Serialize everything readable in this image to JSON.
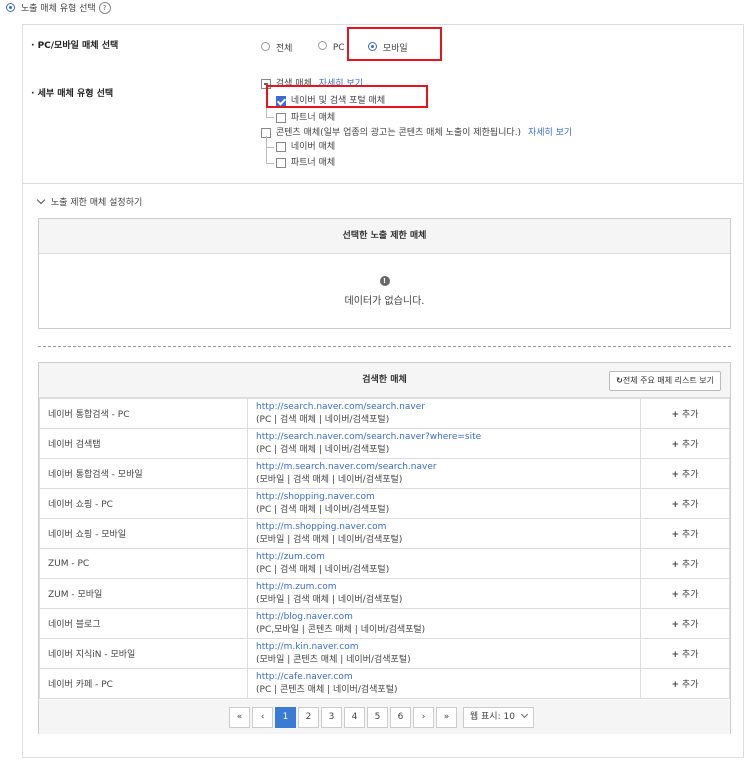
{
  "header": {
    "title": "노출 매체 유형 선택",
    "help": "?"
  },
  "media_select": {
    "label": "PC/모바일 매체 선택",
    "options": [
      {
        "label": "전체",
        "checked": false
      },
      {
        "label": "PC",
        "checked": false
      },
      {
        "label": "모바일",
        "checked": true
      }
    ]
  },
  "detail": {
    "label": "세부 매체 유형 선택",
    "search_group": {
      "label": "검색 매체",
      "detail_link": "자세히 보기"
    },
    "naver_search_portal": "네이버 및 검색 포털 매체",
    "partner1": "파트너 매체",
    "content_group": {
      "label": "콘텐츠 매체(일부 업종의 광고는 콘텐츠 매체 노출이 제한됩니다.)",
      "detail_link": "자세히 보기"
    },
    "naver_media": "네이버 매체",
    "partner2": "파트너 매체"
  },
  "restrict": {
    "toggle": "노출 제한 매체 설정하기",
    "selected_title": "선택한 노출 제한 매체",
    "empty_icon": "!",
    "empty_text": "데이터가 없습니다."
  },
  "results": {
    "title": "검색한 매체",
    "list_button": "전체 주요 매체 리스트 보기",
    "add_label": "추가",
    "rows": [
      {
        "name": "네이버 통합검색 - PC",
        "url": "http://search.naver.com/search.naver",
        "desc": "(PC | 검색 매체 | 네이버/검색포털)"
      },
      {
        "name": "네이버 검색탭",
        "url": "http://search.naver.com/search.naver?where=site",
        "desc": "(PC | 검색 매체 | 네이버/검색포털)"
      },
      {
        "name": "네이버 통합검색 - 모바일",
        "url": "http://m.search.naver.com/search.naver",
        "desc": "(모바일 | 검색 매체 | 네이버/검색포털)"
      },
      {
        "name": "네이버 쇼핑 - PC",
        "url": "http://shopping.naver.com",
        "desc": "(PC | 검색 매체 | 네이버/검색포털)"
      },
      {
        "name": "네이버 쇼핑 - 모바일",
        "url": "http://m.shopping.naver.com",
        "desc": "(모바일 | 검색 매체 | 네이버/검색포털)"
      },
      {
        "name": "ZUM - PC",
        "url": "http://zum.com",
        "desc": "(PC | 검색 매체 | 네이버/검색포털)"
      },
      {
        "name": "ZUM - 모바일",
        "url": "http://m.zum.com",
        "desc": "(모바일 | 검색 매체 | 네이버/검색포털)"
      },
      {
        "name": "네이버 블로그",
        "url": "http://blog.naver.com",
        "desc": "(PC,모바일 | 콘텐츠 매체 | 네이버/검색포털)"
      },
      {
        "name": "네이버 지식iN - 모바일",
        "url": "http://m.kin.naver.com",
        "desc": "(모바일 | 콘텐츠 매체 | 네이버/검색포털)"
      },
      {
        "name": "네이버 카페 - PC",
        "url": "http://cafe.naver.com",
        "desc": "(PC | 콘텐츠 매체 | 네이버/검색포털)"
      }
    ]
  },
  "pagination": {
    "first": "«",
    "prev": "‹",
    "next": "›",
    "last": "»",
    "pages": [
      "1",
      "2",
      "3",
      "4",
      "5",
      "6"
    ],
    "current": "1",
    "per_page_label": "웹 표시: 10"
  },
  "colors": {
    "accent": "#3a6bd6",
    "highlight": "#e8141b"
  }
}
